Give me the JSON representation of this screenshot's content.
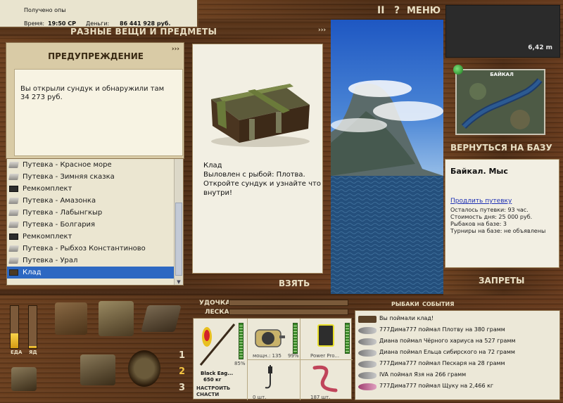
{
  "status": {
    "line1": "Получено опы",
    "time_label": "Время:",
    "time_value": "19:50 СР",
    "money_label": "Деньги:",
    "money_value": "86 441 928 руб."
  },
  "topmenu": {
    "pause": "II",
    "help": "?",
    "menu": "МЕНЮ"
  },
  "depth": "6,42 m",
  "items_window": {
    "title": "РАЗНЫЕ ВЕЩИ И ПРЕДМЕТЫ",
    "arrows": "›››",
    "take_button": "ВЗЯТЬ",
    "detail": {
      "name": "Клад",
      "line2": "Выловлен с рыбой: Плотва.",
      "line3": "Откройте сундук и узнайте что внутри!"
    },
    "list": [
      {
        "label": "Путевка - Красное море",
        "icon": "ticket-icon"
      },
      {
        "label": "Путевка - Зимняя сказка",
        "icon": "ticket-icon"
      },
      {
        "label": "Ремкомплект",
        "icon": "repair-kit-icon"
      },
      {
        "label": "Путевка - Амазонка",
        "icon": "ticket-icon"
      },
      {
        "label": "Путевка - Лабынгкыр",
        "icon": "ticket-icon"
      },
      {
        "label": "Путевка - Болгария",
        "icon": "ticket-icon"
      },
      {
        "label": "Ремкомплект",
        "icon": "repair-kit-icon"
      },
      {
        "label": "Путевка - Рыбхоз Константиново",
        "icon": "ticket-icon"
      },
      {
        "label": "Путевка - Урал",
        "icon": "ticket-icon"
      },
      {
        "label": "Клад",
        "icon": "chest-icon",
        "selected": true
      }
    ],
    "scroll_position": 0.55
  },
  "warning": {
    "title": "ПРЕДУПРЕЖДЕНИЕ",
    "arrows": "›››",
    "message": "Вы открыли сундук и обнаружили там 34 273 руб."
  },
  "right_panel": {
    "map_title": "БАЙКАЛ",
    "return_button": "ВЕРНУТЬСЯ НА БАЗУ",
    "place": "Байкал. Мыс",
    "extend_link": "Продлить путевку",
    "stats": [
      "Осталось путевки: 93 час.",
      "Стоимость дня: 25 000 руб.",
      "Рыбаков на базе: 3",
      "Турниры на базе: не объявлены"
    ],
    "bans_button": "ЗАПРЕТЫ"
  },
  "bottom": {
    "rod_label": "УДОЧКА",
    "line_label": "ЛЕСКА",
    "tab_fishers": "РЫБАКИ",
    "tab_events": "СОБЫТИЯ",
    "energy_label": "ЕДА",
    "poison_label": "ЯД",
    "energy_level": 0.35,
    "poison_level": 0.05,
    "slots": [
      "1",
      "2",
      "3"
    ],
    "active_slot": "2",
    "tackle": {
      "rod_name": "Black Eag...",
      "rod_weight": "650 кг",
      "rod_pct": "85%",
      "reel_info": "мощн.: 135",
      "reel_pct": "99%",
      "line_name": "Power Pro...",
      "hook_count": "0 шт.",
      "bait_count": "187 шт.",
      "setup_button": "НАСТРОИТЬ СНАСТИ"
    },
    "events": [
      "Вы поймали клад!",
      "777Дима777 поймал Плотву на 380 грамм",
      "Диана поймал Чёрного хариуса на 527 грамм",
      "Диана поймал Ельца сибирского на 72 грамм",
      "777Дима777 поймал Пескаря на 28 грамм",
      "IVA поймал Язя на 266 грамм",
      "777Дима777 поймал Щуку на 2,466 кг"
    ]
  },
  "colors": {
    "accent_text": "#e9dfc3",
    "selection": "#2d68c2",
    "link": "#1c2fb4"
  }
}
